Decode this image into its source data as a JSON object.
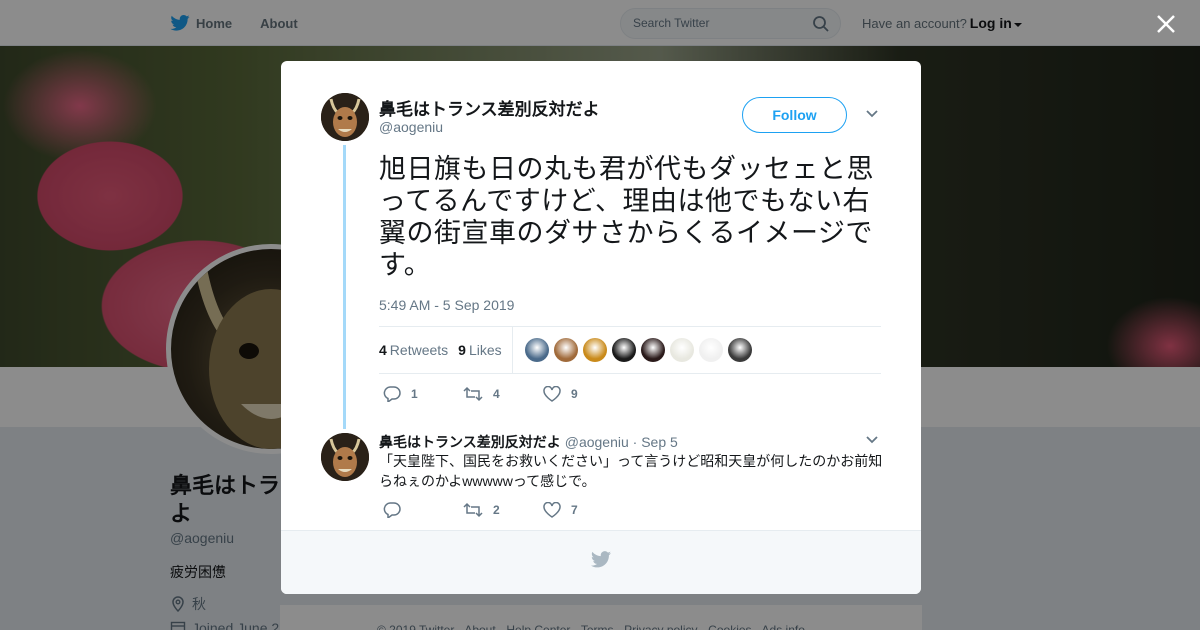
{
  "nav": {
    "home": "Home",
    "about": "About",
    "search_placeholder": "Search Twitter",
    "have_account": "Have an account?",
    "login": "Log in"
  },
  "profile": {
    "name": "鼻毛はトランス差別反対だよ",
    "name_visible": "鼻毛はトラ",
    "name_line2": "よ",
    "handle": "@aogeniu",
    "bio": "疲労困憊",
    "location": "秋",
    "joined": "Joined June 2"
  },
  "tweet": {
    "name": "鼻毛はトランス差別反対だよ",
    "handle": "@aogeniu",
    "follow_label": "Follow",
    "text": "旭日旗も日の丸も君が代もダッセェと思ってるんですけど、理由は他でもない右翼の街宣車のダサさからくるイメージです。",
    "time": "5:49 AM - 5 Sep 2019",
    "retweets_count": "4",
    "retweets_label": "Retweets",
    "likes_count": "9",
    "likes_label": "Likes",
    "actions": {
      "reply": "1",
      "retweet": "4",
      "like": "9"
    }
  },
  "reply": {
    "name": "鼻毛はトランス差別反対だよ",
    "handle": "@aogeniu",
    "date": "· Sep 5",
    "text": "「天皇陛下、国民をお救いください」って言うけど昭和天皇が何したのかお前知らねぇのかよwwwwwって感じで。",
    "actions": {
      "reply": "",
      "retweet": "2",
      "like": "7"
    }
  },
  "footer": "© 2019 Twitter  ·  About  ·  Help Center  ·  Terms  ·  Privacy policy  ·  Cookies  ·  Ads info",
  "colors": {
    "accent": "#1da1f2",
    "thread": "#a4d9f9",
    "muted": "#657786"
  },
  "liker_faces": [
    "#4a6a8a",
    "#a06a3a",
    "#c98a1a",
    "#1a1a1a",
    "#2a1a1a",
    "#e8e8e0",
    "#f0f0f0",
    "#3a3a3a"
  ]
}
